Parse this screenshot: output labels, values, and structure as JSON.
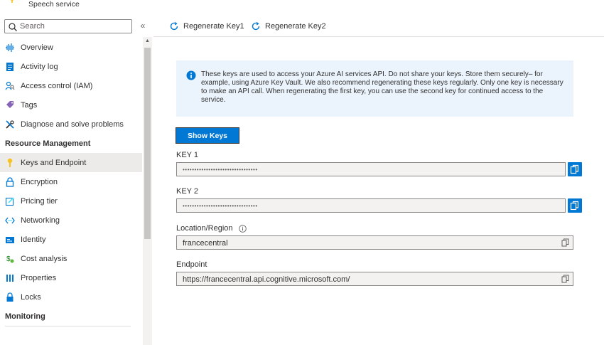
{
  "window": {
    "title": "Speech service"
  },
  "sidebar": {
    "search_placeholder": "Search",
    "collapse_glyph": "«",
    "items": [
      {
        "label": "Overview",
        "icon": "overview-icon"
      },
      {
        "label": "Activity log",
        "icon": "activity-log-icon"
      },
      {
        "label": "Access control (IAM)",
        "icon": "access-control-icon"
      },
      {
        "label": "Tags",
        "icon": "tag-icon"
      },
      {
        "label": "Diagnose and solve problems",
        "icon": "wrench-icon"
      }
    ],
    "section_resource_management": "Resource Management",
    "resource_items": [
      {
        "label": "Keys and Endpoint",
        "icon": "key-icon",
        "active": true
      },
      {
        "label": "Encryption",
        "icon": "lock-icon"
      },
      {
        "label": "Pricing tier",
        "icon": "edit-icon"
      },
      {
        "label": "Networking",
        "icon": "networking-icon"
      },
      {
        "label": "Identity",
        "icon": "identity-icon"
      },
      {
        "label": "Cost analysis",
        "icon": "cost-analysis-icon"
      },
      {
        "label": "Properties",
        "icon": "properties-icon"
      },
      {
        "label": "Locks",
        "icon": "lock-icon"
      }
    ],
    "section_monitoring": "Monitoring"
  },
  "toolbar": {
    "regenerate_key1": "Regenerate Key1",
    "regenerate_key2": "Regenerate Key2"
  },
  "info": {
    "message": "These keys are used to access your Azure AI services API. Do not share your keys. Store them securely– for example, using Azure Key Vault. We also recommend regenerating these keys regularly. Only one key is necessary to make an API call. When regenerating the first key, you can use the second key for continued access to the service."
  },
  "show_keys_label": "Show Keys",
  "key1": {
    "label": "KEY 1",
    "value": "••••••••••••••••••••••••••••••••"
  },
  "key2": {
    "label": "KEY 2",
    "value": "••••••••••••••••••••••••••••••••"
  },
  "location": {
    "label": "Location/Region",
    "value": "francecentral"
  },
  "endpoint": {
    "label": "Endpoint",
    "value": "https://francecentral.api.cognitive.microsoft.com/"
  },
  "colors": {
    "accent": "#0078d4",
    "info_bg": "#ebf3fc",
    "active_nav_bg": "#edebe9"
  }
}
